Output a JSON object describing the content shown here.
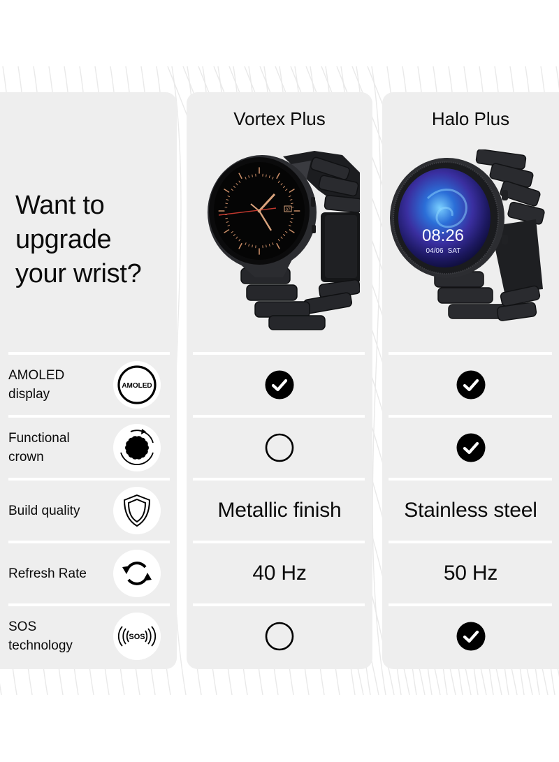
{
  "headline": {
    "lines": [
      "Want to",
      "upgrade",
      "your wrist?"
    ]
  },
  "colors": {
    "card_bg": "#eeeeee",
    "page_bg": "#ffffff",
    "text": "#0b0b0b",
    "check_fill": "#000000"
  },
  "features": [
    {
      "label_lines": [
        "AMOLED",
        "display"
      ],
      "icon": "amoled-icon",
      "icon_text": "AMOLED"
    },
    {
      "label_lines": [
        "Functional",
        "crown"
      ],
      "icon": "rotating-crown-icon"
    },
    {
      "label_lines": [
        "Build quality"
      ],
      "icon": "shield-icon"
    },
    {
      "label_lines": [
        "Refresh Rate"
      ],
      "icon": "refresh-icon"
    },
    {
      "label_lines": [
        "SOS",
        "technology"
      ],
      "icon": "sos-icon",
      "icon_text": "((SOS))"
    }
  ],
  "products": [
    {
      "name": "Vortex Plus",
      "image": "black-smartwatch-analog-face",
      "watch_face": {
        "date_badge": "07"
      },
      "values": [
        {
          "type": "check",
          "value": true
        },
        {
          "type": "check",
          "value": false
        },
        {
          "type": "text",
          "value": "Metallic finish"
        },
        {
          "type": "text",
          "value": "40 Hz"
        },
        {
          "type": "check",
          "value": false
        }
      ]
    },
    {
      "name": "Halo Plus",
      "image": "black-smartwatch-galaxy-face",
      "watch_face": {
        "time": "08:26",
        "date": "04/06",
        "day": "SAT"
      },
      "values": [
        {
          "type": "check",
          "value": true
        },
        {
          "type": "check",
          "value": true
        },
        {
          "type": "text",
          "value": "Stainless steel"
        },
        {
          "type": "text",
          "value": "50 Hz"
        },
        {
          "type": "check",
          "value": true
        }
      ]
    }
  ]
}
